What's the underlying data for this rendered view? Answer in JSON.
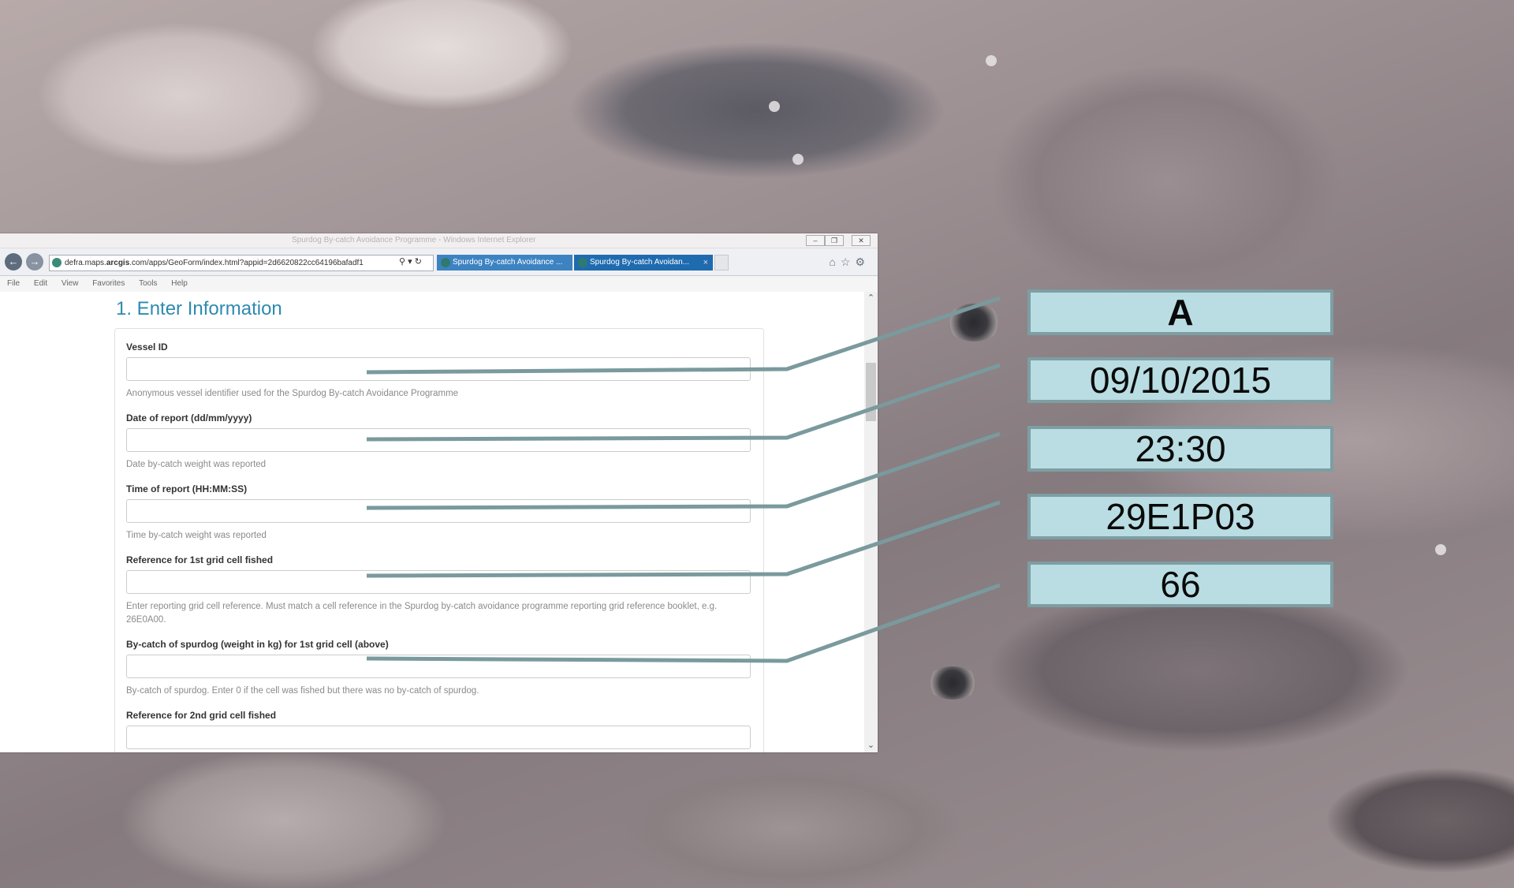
{
  "browser": {
    "window_title": "Spurdog By-catch Avoidance Programme - Windows Internet Explorer",
    "address": "http://defra.maps.arcgis.com/apps/GeoForm/index.html?appid=2d6620822cc64196bafadf1",
    "address_domain": "defra.maps.",
    "address_bold": "arcgis",
    "address_rest": ".com/apps/GeoForm/index.html?appid=2d6620822cc64196bafadf1",
    "tabs": [
      {
        "label": "Spurdog By-catch Avoidance ..."
      },
      {
        "label": "Spurdog By-catch Avoidan..."
      }
    ],
    "close_tab_glyph": "×",
    "menu": [
      "File",
      "Edit",
      "View",
      "Favorites",
      "Tools",
      "Help"
    ]
  },
  "form": {
    "section_title": "1. Enter Information",
    "fields": [
      {
        "label": "Vessel ID",
        "value": "",
        "help": "Anonymous vessel identifier used for the Spurdog By-catch Avoidance Programme"
      },
      {
        "label": "Date of report (dd/mm/yyyy)",
        "value": "",
        "help": "Date by-catch weight was reported"
      },
      {
        "label": "Time of report (HH:MM:SS)",
        "value": "",
        "help": "Time by-catch weight was reported"
      },
      {
        "label": "Reference for 1st grid cell fished",
        "value": "",
        "help": "Enter reporting grid cell reference. Must match a cell reference in the Spurdog by-catch avoidance programme reporting grid reference booklet, e.g. 26E0A00."
      },
      {
        "label": "By-catch of spurdog (weight in kg) for 1st grid cell (above)",
        "value": "",
        "help": "By-catch of spurdog. Enter 0 if the cell was fished but there was no by-catch of spurdog."
      },
      {
        "label": "Reference for 2nd grid cell fished",
        "value": ""
      }
    ]
  },
  "callouts": [
    "A",
    "09/10/2015",
    "23:30",
    "29E1P03",
    "66"
  ],
  "colors": {
    "callout_fill": "#b9dde2",
    "callout_border": "#7d9ea3",
    "leader_line": "#7a9a9d",
    "title_blue": "#2e8ab0"
  }
}
